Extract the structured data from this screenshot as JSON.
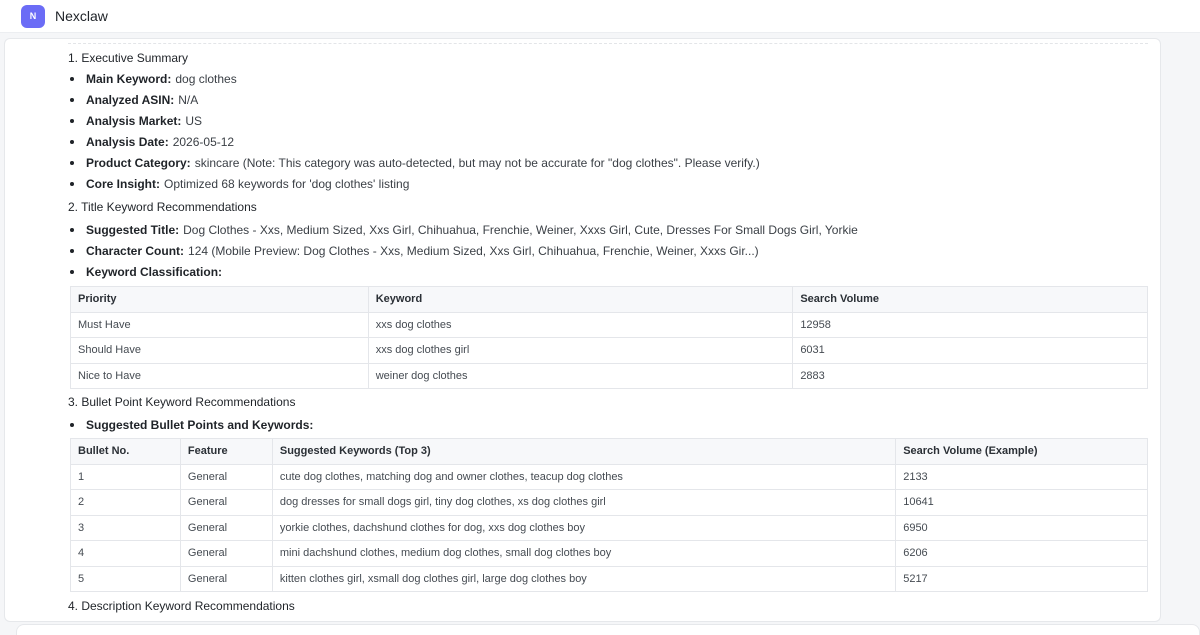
{
  "app": {
    "avatar_letter": "N",
    "title": "Nexclaw"
  },
  "section1": {
    "title": "1. Executive Summary",
    "items": [
      {
        "label": "Main Keyword:",
        "value": "dog clothes"
      },
      {
        "label": "Analyzed ASIN:",
        "value": "N/A"
      },
      {
        "label": "Analysis Market:",
        "value": "US"
      },
      {
        "label": "Analysis Date:",
        "value": "2026-05-12"
      },
      {
        "label": "Product Category:",
        "value": "skincare (Note: This category was auto-detected, but may not be accurate for \"dog clothes\". Please verify.)"
      },
      {
        "label": "Core Insight:",
        "value": "Optimized 68 keywords for 'dog clothes' listing"
      }
    ]
  },
  "section2": {
    "title": "2. Title Keyword Recommendations",
    "items": [
      {
        "label": "Suggested Title:",
        "value": "Dog Clothes - Xxs, Medium Sized, Xxs Girl, Chihuahua, Frenchie, Weiner, Xxxs Girl, Cute, Dresses For Small Dogs Girl, Yorkie"
      },
      {
        "label": "Character Count:",
        "value": "124 (Mobile Preview: Dog Clothes - Xxs, Medium Sized, Xxs Girl, Chihuahua, Frenchie, Weiner, Xxxs Gir...)"
      },
      {
        "label": "Keyword Classification:",
        "value": ""
      }
    ],
    "table": {
      "headers": [
        "Priority",
        "Keyword",
        "Search Volume"
      ],
      "rows": [
        [
          "Must Have",
          "xxs dog clothes",
          "12958"
        ],
        [
          "Should Have",
          "xxs dog clothes girl",
          "6031"
        ],
        [
          "Nice to Have",
          "weiner dog clothes",
          "2883"
        ]
      ]
    }
  },
  "section3": {
    "title": "3. Bullet Point Keyword Recommendations",
    "items": [
      {
        "label": "Suggested Bullet Points and Keywords:",
        "value": ""
      }
    ],
    "table": {
      "headers": [
        "Bullet No.",
        "Feature",
        "Suggested Keywords (Top 3)",
        "Search Volume (Example)"
      ],
      "rows": [
        [
          "1",
          "General",
          "cute dog clothes, matching dog and owner clothes, teacup dog clothes",
          "2133"
        ],
        [
          "2",
          "General",
          "dog dresses for small dogs girl, tiny dog clothes, xs dog clothes girl",
          "10641"
        ],
        [
          "3",
          "General",
          "yorkie clothes, dachshund clothes for dog, xxs dog clothes boy",
          "6950"
        ],
        [
          "4",
          "General",
          "mini dachshund clothes, medium dog clothes, small dog clothes boy",
          "6206"
        ],
        [
          "5",
          "General",
          "kitten clothes girl, xsmall dog clothes girl, large dog clothes boy",
          "5217"
        ]
      ]
    }
  },
  "section4": {
    "title": "4. Description Keyword Recommendations"
  }
}
